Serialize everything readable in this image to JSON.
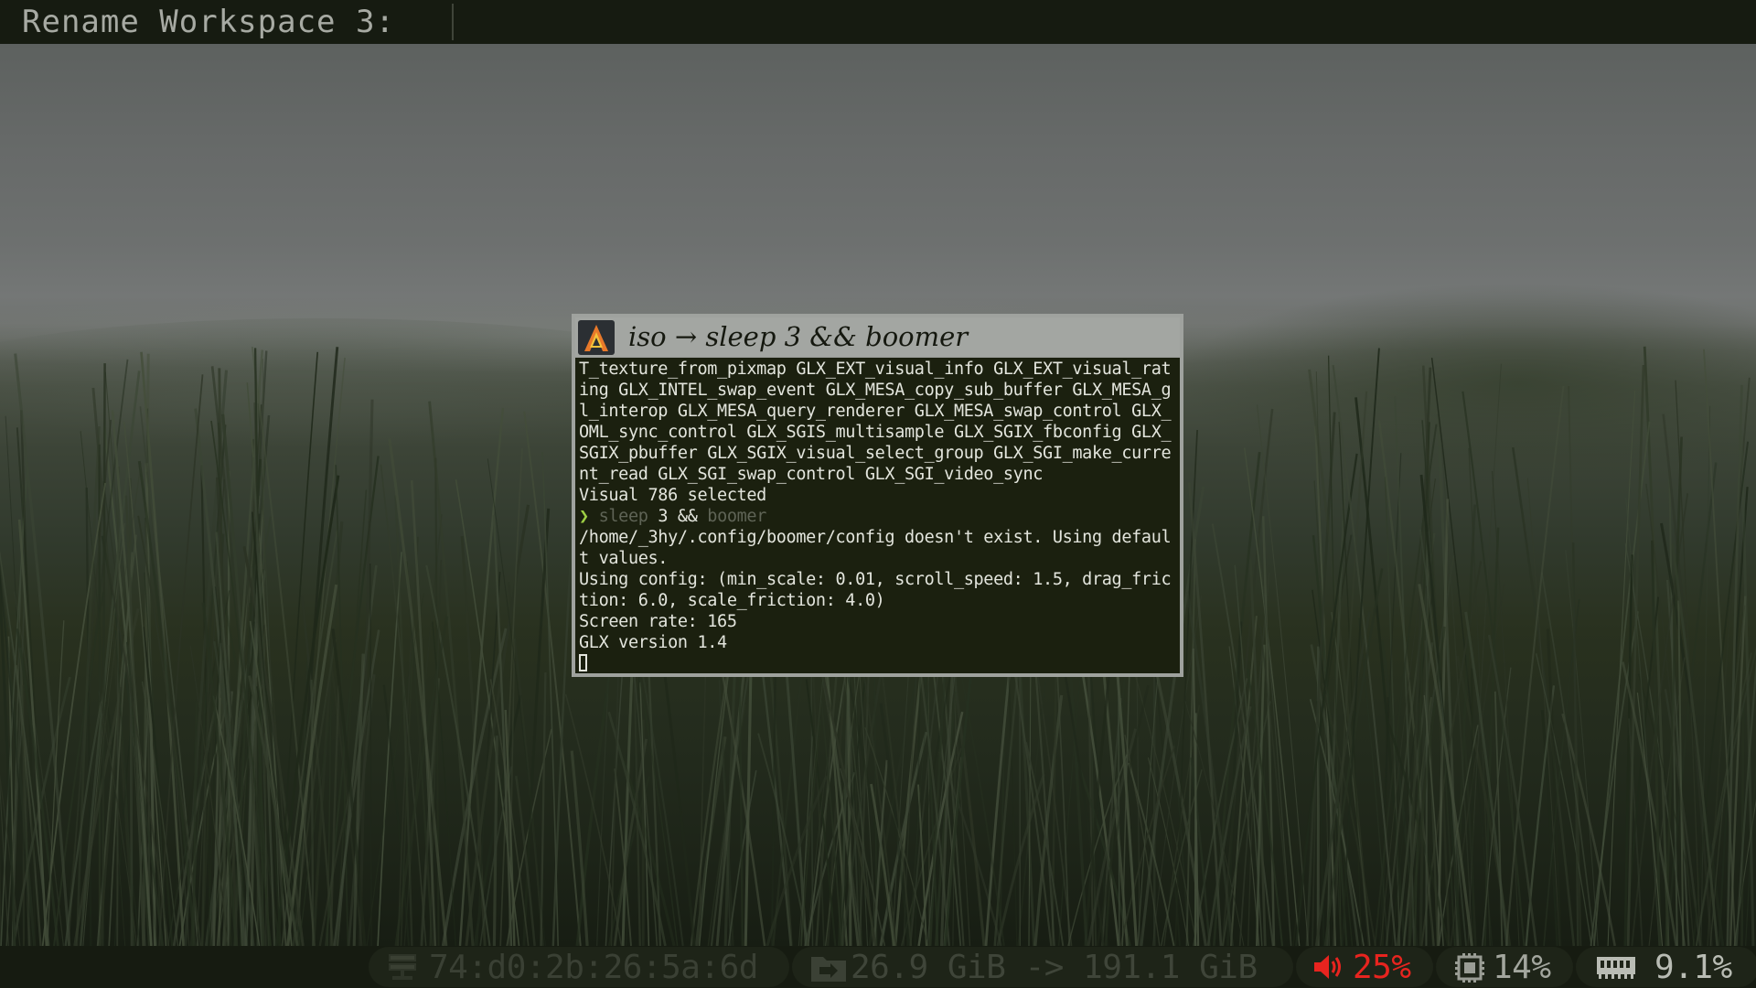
{
  "top_bar": {
    "prompt": "Rename Workspace 3:"
  },
  "terminal": {
    "app_icon": "alacritty-icon",
    "title": "iso → sleep 3 && boomer",
    "lines": [
      "T_texture_from_pixmap GLX_EXT_visual_info GLX_EXT_visual_rat",
      "ing GLX_INTEL_swap_event GLX_MESA_copy_sub_buffer GLX_MESA_g",
      "l_interop GLX_MESA_query_renderer GLX_MESA_swap_control GLX_",
      "OML_sync_control GLX_SGIS_multisample GLX_SGIX_fbconfig GLX_",
      "SGIX_pbuffer GLX_SGIX_visual_select_group GLX_SGI_make_curre",
      "nt_read GLX_SGI_swap_control GLX_SGI_video_sync",
      "Visual 786 selected"
    ],
    "command": {
      "arrow": "❯",
      "part1": "sleep",
      "part2": " 3 && ",
      "part3": "boomer"
    },
    "output_lines": [
      "/home/_3hy/.config/boomer/config doesn't exist. Using defaul",
      "t values.",
      "Using config: (min_scale: 0.01, scroll_speed: 1.5, drag_fric",
      "tion: 6.0, scale_friction: 4.0)",
      "Screen rate: 165",
      "GLX version 1.4"
    ]
  },
  "status_bar": {
    "network": {
      "icon": "network-icon",
      "text": "74:d0:2b:26:5a:6d"
    },
    "disk": {
      "icon": "disk-icon",
      "text": "26.9 GiB -> 191.1 GiB"
    },
    "volume": {
      "icon": "speaker-icon",
      "text": "25%",
      "color": "#e8241f"
    },
    "cpu": {
      "icon": "cpu-icon",
      "text": "14%"
    },
    "memory": {
      "icon": "memory-icon",
      "text": "9.1%"
    }
  },
  "colors": {
    "bar_bg": "#161b11",
    "terminal_bg": "#1b200f",
    "prompt_green": "#9ecf44",
    "volume_red": "#e8241f"
  }
}
